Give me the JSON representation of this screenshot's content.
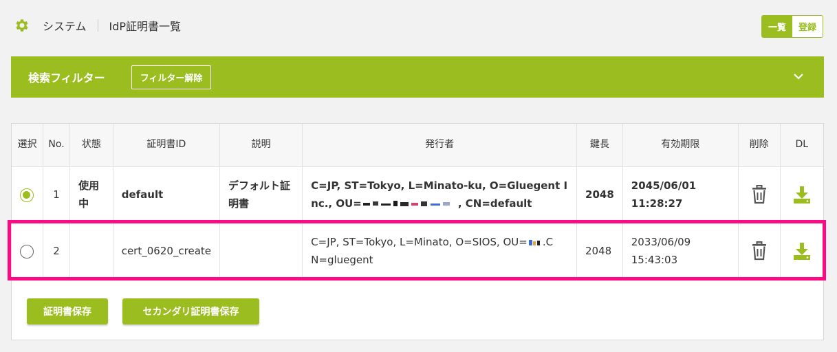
{
  "header": {
    "section": "システム",
    "page": "IdP証明書一覧",
    "view_list": "一覧",
    "view_register": "登録"
  },
  "filter": {
    "title": "検索フィルター",
    "clear_label": "フィルター解除"
  },
  "table": {
    "columns": [
      "選択",
      "No.",
      "状態",
      "証明書ID",
      "説明",
      "発行者",
      "鍵長",
      "有効期限",
      "削除",
      "DL"
    ],
    "rows": [
      {
        "selected": true,
        "no": "1",
        "status": "使用中",
        "cert_id": "default",
        "description": "デフォルト証明書",
        "issuer_a": "C=JP, ST=Tokyo, L=Minato-ku, O=Gluegent I",
        "issuer_b_pre": "nc., OU=",
        "issuer_b_post": ", CN=default",
        "key_length": "2048",
        "expiry": "2045/06/01 11:28:27"
      },
      {
        "selected": false,
        "no": "2",
        "status": "",
        "cert_id": "cert_0620_create",
        "description": "",
        "issuer_a_pre": "C=JP, ST=Tokyo, L=Minato, O=SIOS, OU=",
        "issuer_a_post": ".C",
        "issuer_b": "N=gluegent",
        "key_length": "2048",
        "expiry": "2033/06/09 15:43:03"
      }
    ]
  },
  "actions": {
    "save_label": "証明書保存",
    "secondary_save_label": "セカンダリ証明書保存"
  },
  "colors": {
    "accent": "#9bbd1f",
    "highlight": "#ff0a85"
  }
}
